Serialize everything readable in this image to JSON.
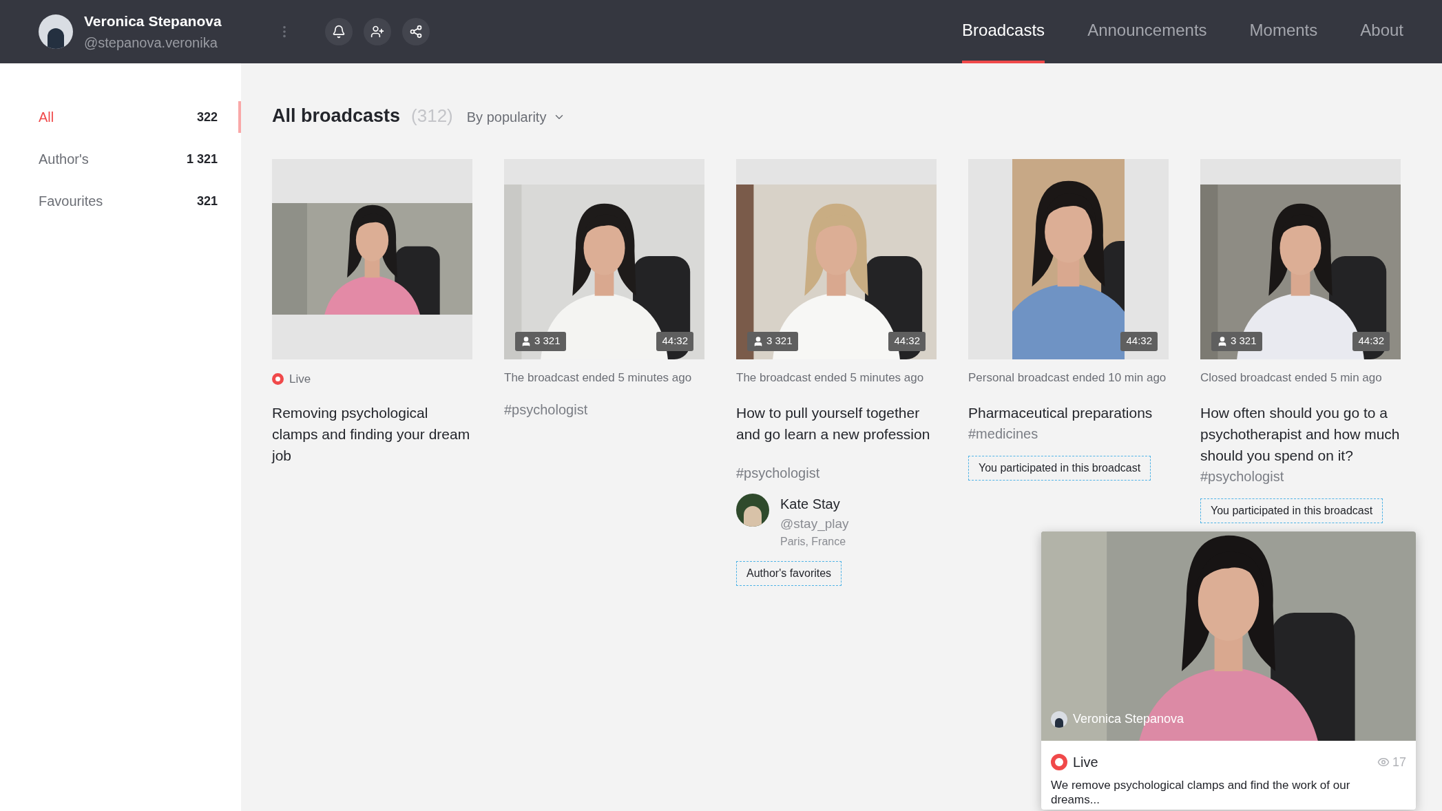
{
  "profile": {
    "name": "Veronica Stepanova",
    "handle": "@stepanova.veronika"
  },
  "nav_tabs": [
    {
      "label": "Broadcasts",
      "selected": true
    },
    {
      "label": "Announcements",
      "selected": false
    },
    {
      "label": "Moments",
      "selected": false
    },
    {
      "label": "About",
      "selected": false
    }
  ],
  "sidebar": {
    "items": [
      {
        "label": "All",
        "count": "322",
        "selected": true
      },
      {
        "label": "Author's",
        "count": "1 321",
        "selected": false
      },
      {
        "label": "Favourites",
        "count": "321",
        "selected": false
      }
    ]
  },
  "heading": {
    "title": "All broadcasts",
    "count": "(312)",
    "sort": "By popularity"
  },
  "broadcasts": [
    {
      "kind": "letterbox",
      "status": {
        "kind": "live",
        "text": "Live"
      },
      "title": "Removing psychological clamps and finding your dream job"
    },
    {
      "kind": "top",
      "viewers": "3 321",
      "duration": "44:32",
      "status": {
        "kind": "ended",
        "text": "The broadcast ended 5 minutes ago"
      },
      "tags": "#psychologist"
    },
    {
      "kind": "top",
      "viewers": "3 321",
      "duration": "44:32",
      "status": {
        "kind": "ended",
        "text": "The broadcast ended 5 minutes ago"
      },
      "title": "How to pull yourself together and go learn a new profession",
      "tags": "#psychologist",
      "author": {
        "name": "Kate Stay",
        "handle": "@stay_play",
        "location": "Paris, France"
      },
      "badge": "Author's favorites"
    },
    {
      "kind": "portrait",
      "duration": "44:32",
      "status": {
        "kind": "ended",
        "text": "Personal broadcast ended 10 min ago"
      },
      "title": "Pharmaceutical preparations",
      "tags": "#medicines",
      "badge": "You participated in this broadcast"
    },
    {
      "kind": "top",
      "viewers": "3 321",
      "duration": "44:32",
      "status": {
        "kind": "ended",
        "text": "Closed broadcast ended 5 min ago"
      },
      "title": "How often should you go to a psychotherapist and how much should you spend on it?",
      "tags": "#psychologist",
      "badge": "You participated in this broadcast"
    }
  ],
  "player": {
    "author": "Veronica Stepanova",
    "status": {
      "kind": "live",
      "text": "Live"
    },
    "views": "17",
    "description": "We remove psychological clamps and find the work of our dreams..."
  }
}
